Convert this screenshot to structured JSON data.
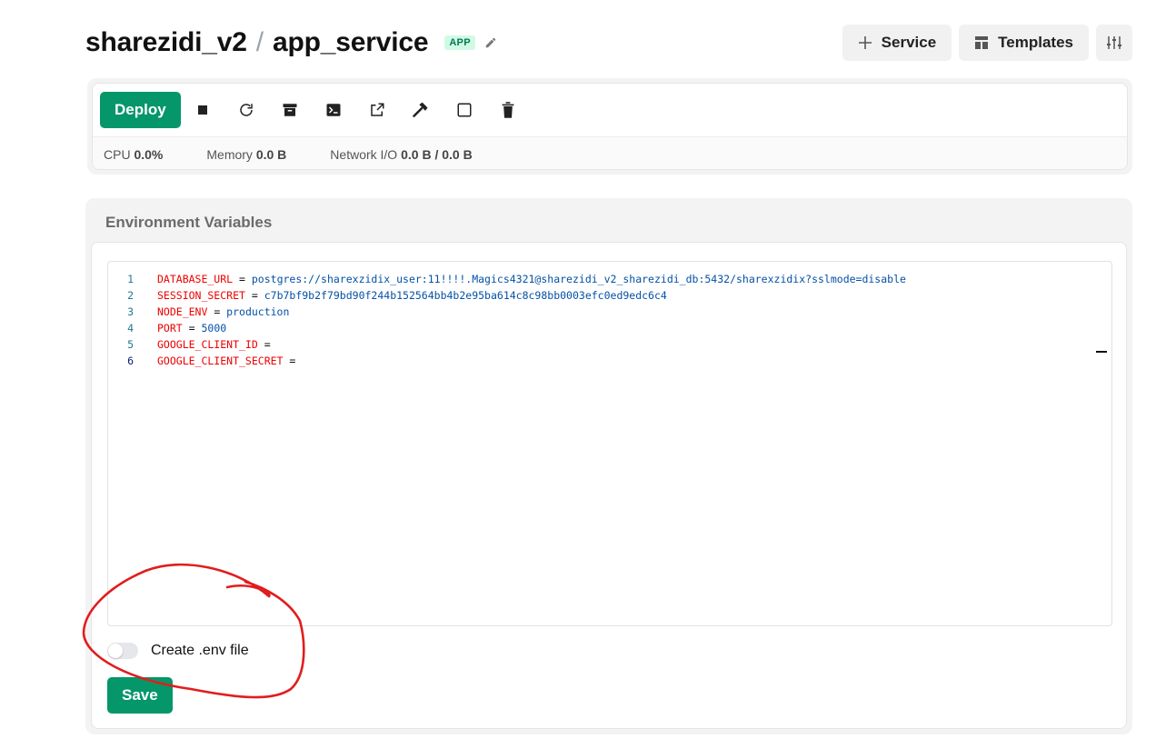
{
  "header": {
    "project": "sharezidi_v2",
    "separator": "/",
    "service": "app_service",
    "badge": "APP",
    "actions": {
      "service_label": "Service",
      "templates_label": "Templates"
    }
  },
  "toolbar": {
    "deploy_label": "Deploy",
    "icons": [
      "stop-icon",
      "restart-icon",
      "archive-icon",
      "terminal-icon",
      "external-link-icon",
      "hammer-icon",
      "square-icon",
      "trash-icon"
    ]
  },
  "stats": {
    "cpu_label": "CPU",
    "cpu_value": "0.0%",
    "memory_label": "Memory",
    "memory_value": "0.0 B",
    "network_label": "Network I/O",
    "network_value": "0.0 B / 0.0 B"
  },
  "env": {
    "title": "Environment Variables",
    "lines": [
      {
        "num": "1",
        "key": "DATABASE_URL",
        "eq": " = ",
        "value": "postgres://sharexzidix_user:11!!!!.Magics4321@sharezidi_v2_sharezidi_db:5432/sharexzidix?sslmode=disable"
      },
      {
        "num": "2",
        "key": "SESSION_SECRET",
        "eq": " = ",
        "value": "c7b7bf9b2f79bd90f244b152564bb4b2e95ba614c8c98bb0003efc0ed9edc6c4"
      },
      {
        "num": "3",
        "key": "NODE_ENV",
        "eq": " = ",
        "value": "production"
      },
      {
        "num": "4",
        "key": "PORT",
        "eq": " = ",
        "value": "5000"
      },
      {
        "num": "5",
        "key": "GOOGLE_CLIENT_ID",
        "eq": " =",
        "value": ""
      },
      {
        "num": "6",
        "key": "GOOGLE_CLIENT_SECRET",
        "eq": " =",
        "value": ""
      }
    ],
    "toggle_label": "Create .env file",
    "toggle_on": false,
    "save_label": "Save"
  },
  "colors": {
    "accent": "#059669",
    "annotation": "#e11d1d"
  }
}
